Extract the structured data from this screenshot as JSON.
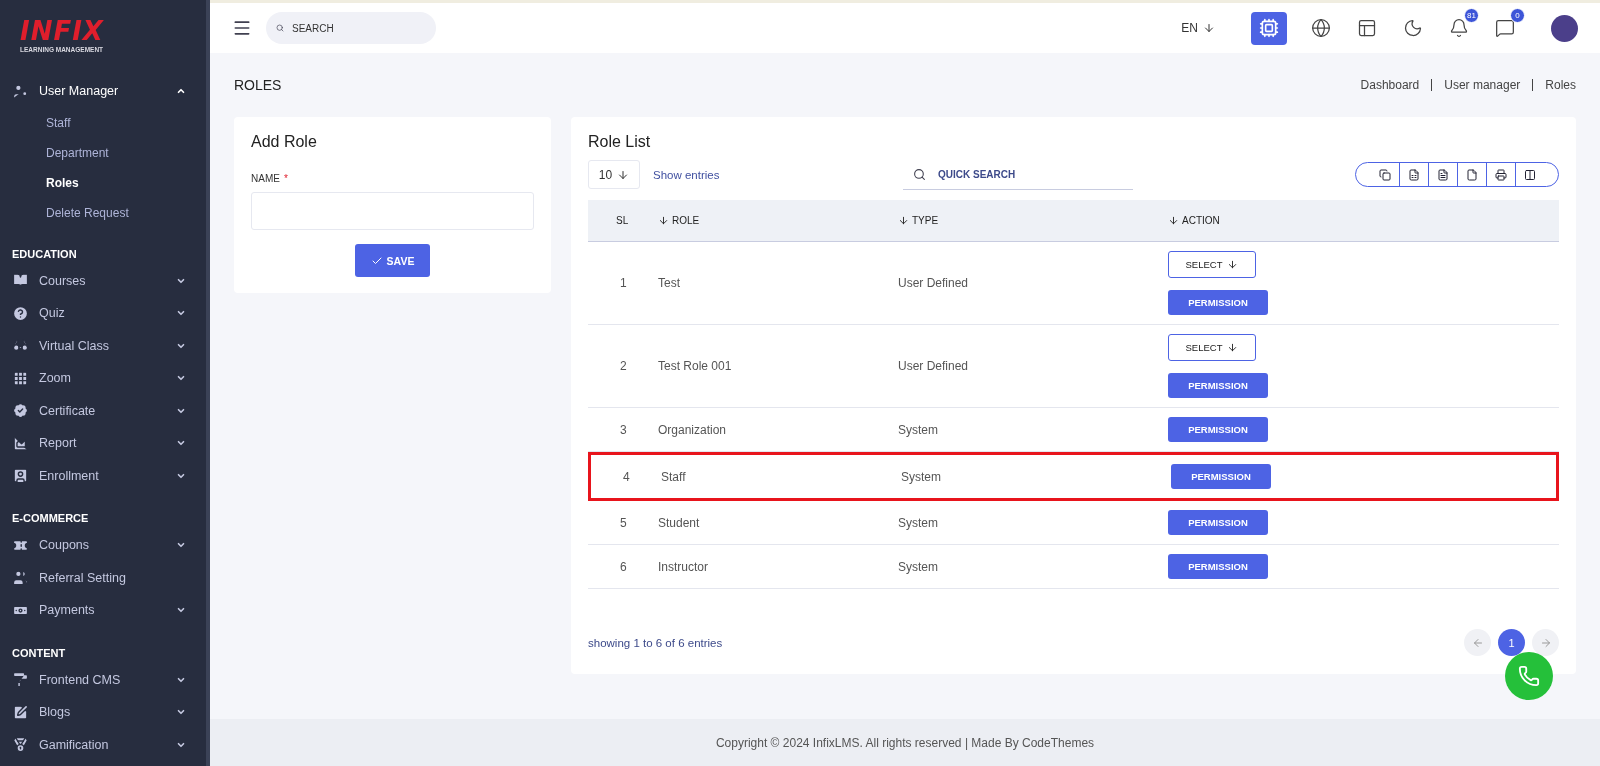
{
  "logo": {
    "brand": "INFIX",
    "tagline": "LEARNING MANAGEMENT"
  },
  "sidebar": {
    "sections": [
      {
        "items": [
          {
            "label": "User Manager",
            "expanded": true,
            "has_caret": true,
            "children": [
              {
                "label": "Staff",
                "selected": false
              },
              {
                "label": "Department",
                "selected": false
              },
              {
                "label": "Roles",
                "selected": true
              },
              {
                "label": "Delete Request",
                "selected": false
              }
            ]
          }
        ]
      },
      {
        "heading": "EDUCATION",
        "items": [
          {
            "label": "Courses",
            "expanded": false,
            "has_caret": true
          },
          {
            "label": "Quiz",
            "expanded": false,
            "has_caret": true
          },
          {
            "label": "Virtual Class",
            "expanded": false,
            "has_caret": true
          },
          {
            "label": "Zoom",
            "expanded": false,
            "has_caret": true
          },
          {
            "label": "Certificate",
            "expanded": false,
            "has_caret": true
          },
          {
            "label": "Report",
            "expanded": false,
            "has_caret": true
          },
          {
            "label": "Enrollment",
            "expanded": false,
            "has_caret": true
          }
        ]
      },
      {
        "heading": "E-COMMERCE",
        "items": [
          {
            "label": "Coupons",
            "expanded": false,
            "has_caret": true
          },
          {
            "label": "Referral Setting",
            "expanded": false,
            "has_caret": false
          },
          {
            "label": "Payments",
            "expanded": false,
            "has_caret": true
          }
        ]
      },
      {
        "heading": "CONTENT",
        "items": [
          {
            "label": "Frontend CMS",
            "expanded": false,
            "has_caret": true
          },
          {
            "label": "Blogs",
            "expanded": false,
            "has_caret": true
          },
          {
            "label": "Gamification",
            "expanded": false,
            "has_caret": true
          }
        ]
      }
    ]
  },
  "topbar": {
    "search_placeholder": "SEARCH",
    "language": "EN",
    "notifications_count": "81",
    "messages_count": "0"
  },
  "page": {
    "title": "ROLES",
    "breadcrumb": [
      "Dashboard",
      "User manager",
      "Roles"
    ]
  },
  "add_role": {
    "title": "Add Role",
    "field_label": "NAME",
    "required_mark": "*",
    "save_label": "SAVE"
  },
  "role_list": {
    "title": "Role List",
    "page_size": "10",
    "show_entries": "Show entries",
    "quick_search_placeholder": "QUICK SEARCH",
    "columns": [
      "SL",
      "ROLE",
      "TYPE",
      "ACTION"
    ],
    "rows": [
      {
        "sl": "1",
        "role": "Test",
        "type": "User Defined",
        "select_label": "SELECT",
        "permission_label": "PERMISSION",
        "highlighted": false
      },
      {
        "sl": "2",
        "role": "Test Role 001",
        "type": "User Defined",
        "select_label": "SELECT",
        "permission_label": "PERMISSION",
        "highlighted": false
      },
      {
        "sl": "3",
        "role": "Organization",
        "type": "System",
        "permission_label": "PERMISSION",
        "highlighted": false
      },
      {
        "sl": "4",
        "role": "Staff",
        "type": "System",
        "permission_label": "PERMISSION",
        "highlighted": true
      },
      {
        "sl": "5",
        "role": "Student",
        "type": "System",
        "permission_label": "PERMISSION",
        "highlighted": false
      },
      {
        "sl": "6",
        "role": "Instructor",
        "type": "System",
        "permission_label": "PERMISSION",
        "highlighted": false
      }
    ],
    "summary": "showing 1 to 6 of 6 entries",
    "pages": [
      {
        "label": "1",
        "selected": true
      }
    ]
  },
  "footer": {
    "text": "Copyright © 2024 InfixLMS. All rights reserved | Made By CodeThemes"
  }
}
